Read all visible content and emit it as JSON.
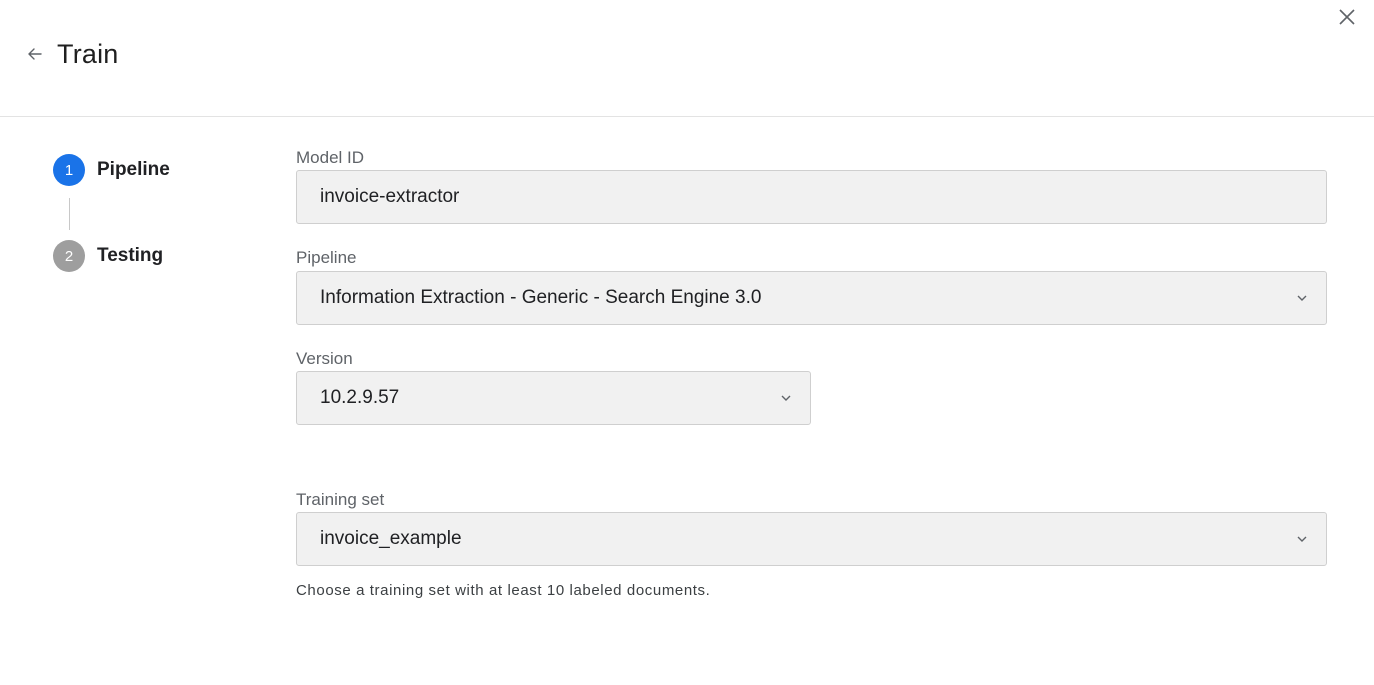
{
  "header": {
    "title": "Train",
    "back_icon": "arrow-left-icon",
    "close_icon": "close-icon"
  },
  "stepper": {
    "steps": [
      {
        "number": "1",
        "label": "Pipeline",
        "state": "active",
        "color": "#1a73e8"
      },
      {
        "number": "2",
        "label": "Testing",
        "state": "inactive",
        "color": "#9e9e9e"
      }
    ]
  },
  "form": {
    "model_id": {
      "label": "Model ID",
      "value": "invoice-extractor"
    },
    "pipeline": {
      "label": "Pipeline",
      "value": "Information Extraction - Generic - Search Engine 3.0"
    },
    "version": {
      "label": "Version",
      "value": "10.2.9.57"
    },
    "training_set": {
      "label": "Training set",
      "value": "invoice_example",
      "helper": "Choose a training set with at least 10 labeled documents."
    }
  }
}
